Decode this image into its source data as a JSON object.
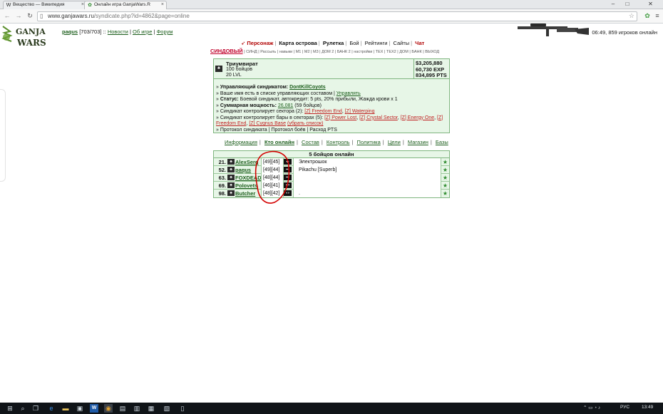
{
  "browser": {
    "tabs": [
      {
        "label": "Вещество — Википедия",
        "icon": "wikipedia-icon"
      },
      {
        "label": "Онлайн игра GanjaWars.R",
        "icon": "ganjawars-leaf-icon"
      }
    ],
    "url_host": "www.ganjawars.ru",
    "url_path": "/syndicate.php?id=4862&page=online"
  },
  "header": {
    "logo_line1": "GANJA",
    "logo_line2": "WARS",
    "username": "paqus",
    "hp": "[703/703]",
    "sep": "::",
    "links": [
      "Новости",
      "Об игре",
      "Форум"
    ],
    "online_text": "06:49, 859 игроков онлайн"
  },
  "main_nav": [
    {
      "label": "Персонаж",
      "style": "red"
    },
    {
      "label": "Карта острова",
      "style": "bold"
    },
    {
      "label": "Рулетка",
      "style": "bold"
    },
    {
      "label": "Бой",
      "style": "normal"
    },
    {
      "label": "Рейтинги",
      "style": "normal"
    },
    {
      "label": "Сайты",
      "style": "normal"
    },
    {
      "label": "Чат",
      "style": "red"
    }
  ],
  "sub_nav": {
    "current": "СИНДОВЫЙ",
    "items": [
      "СИНД",
      "Рассыль",
      "навыки",
      "М1",
      "М2",
      "М3",
      "ДОМ 2",
      "БАНК 2",
      "настройки",
      "ТЕХ",
      "ТЕХ2",
      "ДОМ",
      "БАНК",
      "ВЫХОД"
    ]
  },
  "syndicate": {
    "name": "Триумвират",
    "members": "100 бойцов",
    "level": "20 LVL",
    "money": "$3,205,880",
    "exp": "60,730 EXP",
    "pts": "834,895 PTS",
    "manager_label": "Управляющий синдикатом:",
    "manager": "DontKillCoyots",
    "line_list": "Ваше имя есть в списке управляющих составом |",
    "line_list_link": "Управлять",
    "status_label": "Статус:",
    "status_text": "Боевой синдикат, автокредит: 5 pts, 20% прибыли, Жажда крови x 1",
    "power_label": "Суммарная мощность:",
    "power_value": "26,081",
    "power_note": "(59 бойцов)",
    "sectors_text": "Синдикат контролирует сектора (2):",
    "sectors": [
      "[Z] Freedom End",
      "[Z] Waterping"
    ],
    "bars_text": "Синдикат контролирует бары в секторах (5):",
    "bars": [
      "[Z] Power Lost",
      "[Z] Crystal Sector",
      "[Z] Energy One",
      "[Z] Freedom End",
      "[Z] Cygnus Base"
    ],
    "bars_remove": "(убрать список)",
    "protocol_links": [
      "Протокол синдиката",
      "Протокол боёв",
      "Расход PTS"
    ]
  },
  "synd_tabs": [
    "Информация",
    "Кто онлайн",
    "Состав",
    "Контроль",
    "Политика",
    "Цели",
    "Магазин",
    "Базы"
  ],
  "online_table": {
    "title": "5 бойцов онлайн",
    "rows": [
      {
        "num": "21.",
        "name": "AlexSerg",
        "levels": "[49][45]",
        "status": "Электрошок"
      },
      {
        "num": "52.",
        "name": "paqus",
        "levels": "[49][44]",
        "status": "Pikachu [Superb]"
      },
      {
        "num": "63.",
        "name": "FOXDEAD",
        "levels": "[48][44]",
        "status": ""
      },
      {
        "num": "69.",
        "name": "Polovets",
        "levels": "[46][41]",
        "status": ""
      },
      {
        "num": "98.",
        "name": "Butcher",
        "levels": "[48][42]",
        "status": "."
      }
    ]
  },
  "taskbar": {
    "lang": "РУС",
    "time": "13:49"
  },
  "colors": {
    "panel_bg": "#e7f6e7",
    "panel_border": "#7fb57f",
    "link": "#1c5e1c",
    "annotation": "#d40000"
  }
}
